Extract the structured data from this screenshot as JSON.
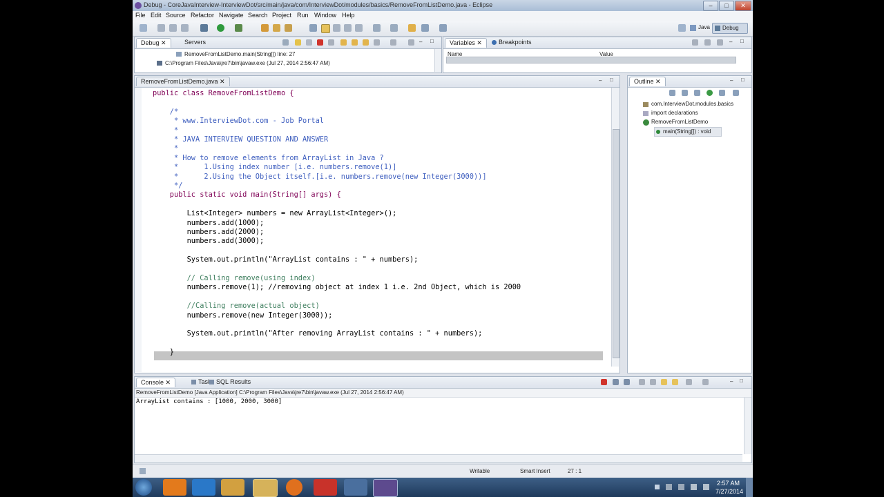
{
  "window": {
    "title": "Debug - CoreJavaInterview-InterviewDot/src/main/java/com/InterviewDot/modules/basics/RemoveFromListDemo.java - Eclipse"
  },
  "menu": [
    "File",
    "Edit",
    "Source",
    "Refactor",
    "Navigate",
    "Search",
    "Project",
    "Run",
    "Window",
    "Help"
  ],
  "perspectives": {
    "java": "Java",
    "debug": "Debug"
  },
  "debug_view": {
    "tabs": [
      "Debug",
      "Servers"
    ],
    "frame": "RemoveFromListDemo.main(String[]) line: 27",
    "process": "C:\\Program Files\\Java\\jre7\\bin\\javaw.exe (Jul 27, 2014 2:56:47 AM)"
  },
  "variables_view": {
    "tabs": [
      "Variables",
      "Breakpoints"
    ],
    "columns": [
      "Name",
      "Value"
    ]
  },
  "editor": {
    "tab": "RemoveFromListDemo.java",
    "lines": [
      {
        "cls": "kw",
        "text": "public class RemoveFromListDemo {"
      },
      {
        "cls": "pl",
        "text": ""
      },
      {
        "cls": "cm",
        "text": "    /*"
      },
      {
        "cls": "cm",
        "text": "     * www.InterviewDot.com - Job Portal"
      },
      {
        "cls": "cm",
        "text": "     *"
      },
      {
        "cls": "cm",
        "text": "     * JAVA INTERVIEW QUESTION AND ANSWER"
      },
      {
        "cls": "cm",
        "text": "     *"
      },
      {
        "cls": "cm",
        "text": "     * How to remove elements from ArrayList in Java ?"
      },
      {
        "cls": "cm",
        "text": "     *      1.Using index number [i.e. numbers.remove(1)]"
      },
      {
        "cls": "cm",
        "text": "     *      2.Using the Object itself.[i.e. numbers.remove(new Integer(3000))]"
      },
      {
        "cls": "cm",
        "text": "     */"
      },
      {
        "cls": "kw",
        "text": "    public static void main(String[] args) {"
      },
      {
        "cls": "pl",
        "text": ""
      },
      {
        "cls": "pl",
        "text": "        List<Integer> numbers = new ArrayList<Integer>();"
      },
      {
        "cls": "pl",
        "text": "        numbers.add(1000);"
      },
      {
        "cls": "pl",
        "text": "        numbers.add(2000);"
      },
      {
        "cls": "pl",
        "text": "        numbers.add(3000);"
      },
      {
        "cls": "pl",
        "text": ""
      },
      {
        "cls": "mix1",
        "text": "        System.out.println(\"ArrayList contains : \" + numbers);"
      },
      {
        "cls": "pl",
        "text": ""
      },
      {
        "cls": "cmg",
        "text": "        // Calling remove(using index)"
      },
      {
        "cls": "hl",
        "text": "        numbers.remove(1); //removing object at index 1 i.e. 2nd Object, which is 2000"
      },
      {
        "cls": "pl",
        "text": ""
      },
      {
        "cls": "cmg",
        "text": "        //Calling remove(actual object)"
      },
      {
        "cls": "mix2",
        "text": "        numbers.remove(new Integer(3000));"
      },
      {
        "cls": "pl",
        "text": ""
      },
      {
        "cls": "mix3",
        "text": "        System.out.println(\"After removing ArrayList contains : \" + numbers);"
      },
      {
        "cls": "pl",
        "text": ""
      },
      {
        "cls": "pl",
        "text": "    }"
      }
    ]
  },
  "outline": {
    "tab": "Outline",
    "items": [
      "com.InterviewDot.modules.basics",
      "import declarations",
      "RemoveFromListDemo",
      "main(String[]) : void"
    ]
  },
  "console": {
    "tabs": [
      "Console",
      "Tasks",
      "SQL Results"
    ],
    "header": "RemoveFromListDemo [Java Application] C:\\Program Files\\Java\\jre7\\bin\\javaw.exe (Jul 27, 2014 2:56:47 AM)",
    "output": "ArrayList contains : [1000, 2000, 3000]"
  },
  "status": {
    "writable": "Writable",
    "insert": "Smart Insert",
    "position": "27 : 1"
  },
  "clock": {
    "time": "2:57 AM",
    "date": "7/27/2014"
  }
}
